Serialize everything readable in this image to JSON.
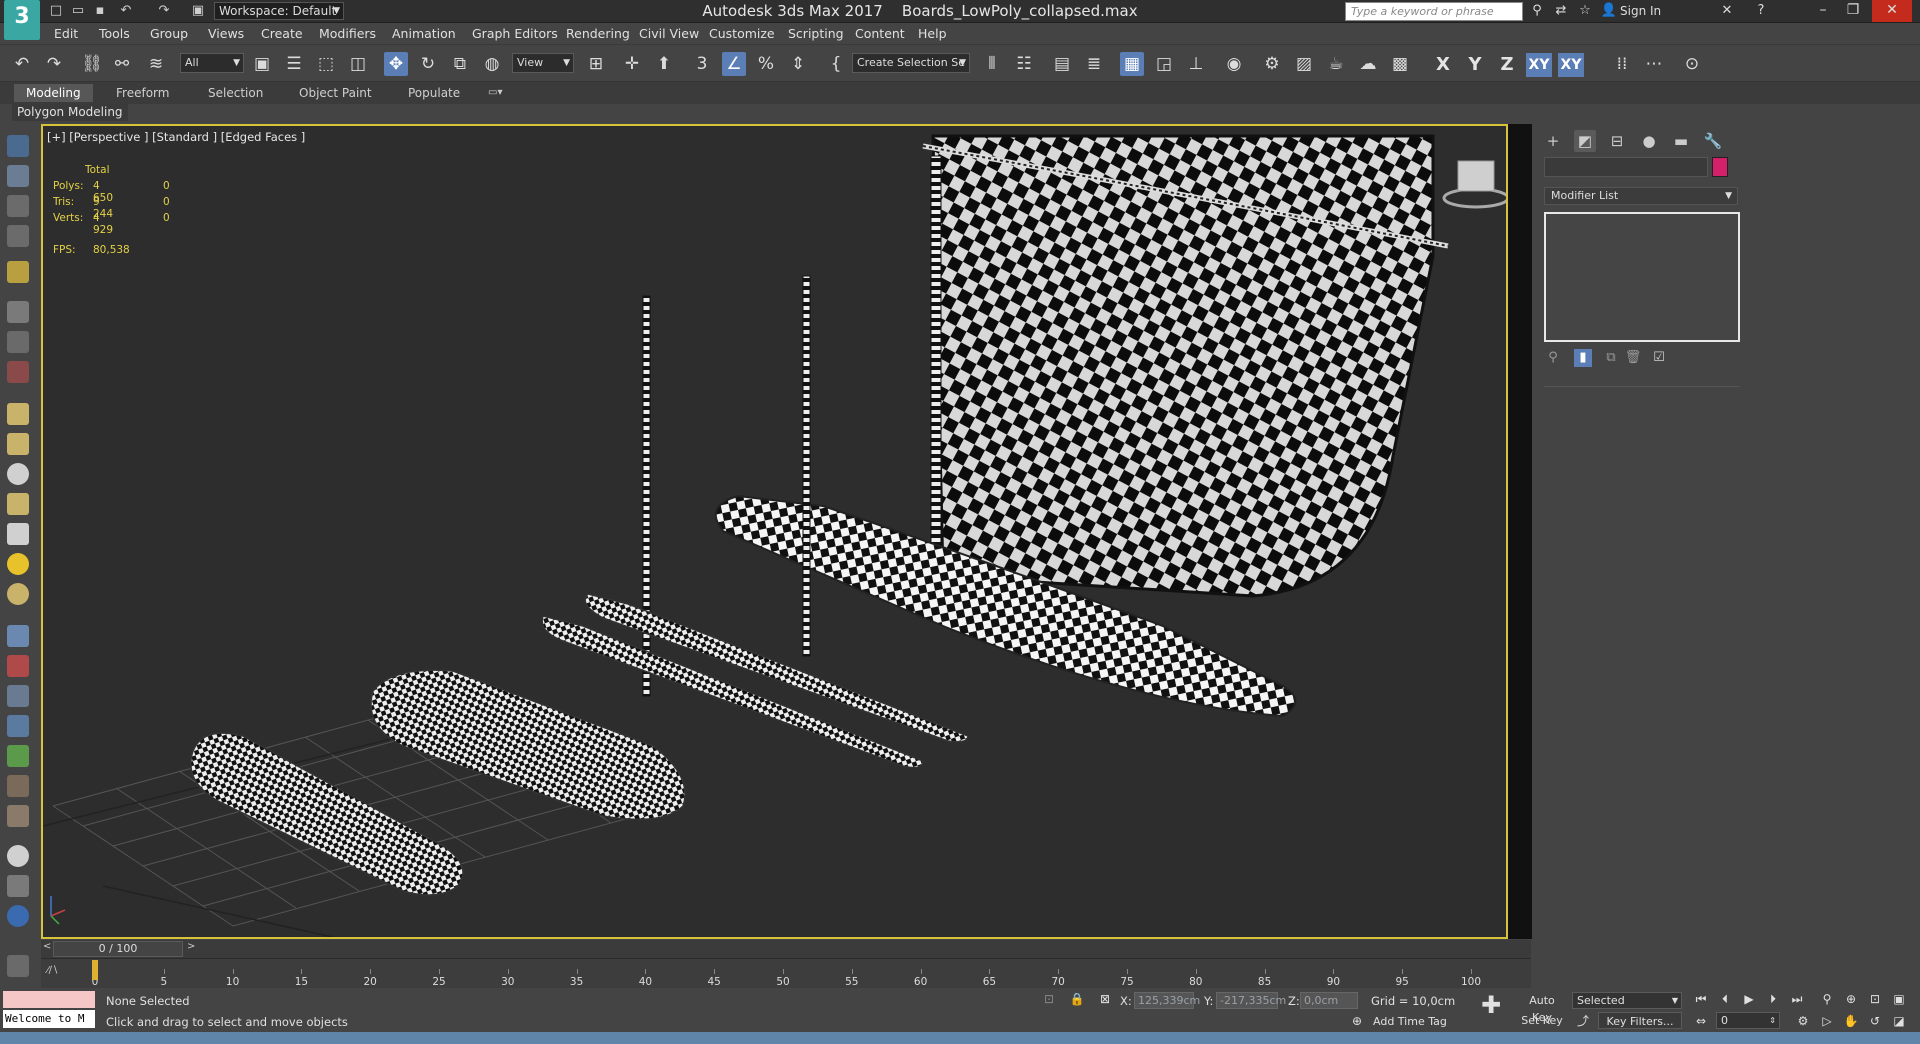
{
  "app": {
    "title": "Autodesk 3ds Max 2017    Boards_LowPoly_collapsed.max",
    "logo": "3",
    "workspace": "Workspace: Default",
    "search_placeholder": "Type a keyword or phrase",
    "signin": "Sign In"
  },
  "menu": [
    "Edit",
    "Tools",
    "Group",
    "Views",
    "Create",
    "Modifiers",
    "Animation",
    "Graph Editors",
    "Rendering",
    "Civil View",
    "Customize",
    "Scripting",
    "Content",
    "Help"
  ],
  "toolbar": {
    "filter": "All",
    "ref_coord": "View",
    "selection_set": "Create Selection Se",
    "axes": {
      "x": "X",
      "y": "Y",
      "z": "Z",
      "xy": "XY",
      "xy2": "XY"
    }
  },
  "ribbon": {
    "tabs": [
      "Modeling",
      "Freeform",
      "Selection",
      "Object Paint",
      "Populate"
    ],
    "active_tab": "Modeling",
    "panel": "Polygon Modeling"
  },
  "viewport": {
    "label": "[+] [Perspective ] [Standard ] [Edged Faces ]",
    "stats": {
      "header": "Total",
      "rows": [
        {
          "label": "Polys:",
          "total": "4 650",
          "sel": "0"
        },
        {
          "label": "Tris:",
          "total": "9 244",
          "sel": "0"
        },
        {
          "label": "Verts:",
          "total": "4 929",
          "sel": "0"
        }
      ],
      "fps_label": "FPS:",
      "fps": "80,538"
    }
  },
  "command_panel": {
    "modifier_list": "Modifier List",
    "object_color": "#d4206b"
  },
  "time": {
    "frame": "0 / 100",
    "ticks": [
      "0",
      "5",
      "10",
      "15",
      "20",
      "25",
      "30",
      "35",
      "40",
      "45",
      "50",
      "55",
      "60",
      "65",
      "70",
      "75",
      "80",
      "85",
      "90",
      "95",
      "100"
    ]
  },
  "status": {
    "selection": "None Selected",
    "prompt": "Click and drag to select and move objects",
    "welcome": "Welcome to M",
    "x_label": "X:",
    "x_value": "125,339cm",
    "y_label": "Y:",
    "y_value": "-217,335cm",
    "z_label": "Z:",
    "z_value": "0,0cm",
    "grid": "Grid = 10,0cm",
    "add_time_tag": "Add Time Tag",
    "auto_key": "Auto Key",
    "set_key": "Set Key",
    "key_mode": "Selected",
    "key_filters": "Key Filters...",
    "current_frame": "0"
  },
  "colors": {
    "viewport_border": "#d6c33b",
    "stats_text": "#e3d146",
    "accent_blue": "#5b7eb7"
  }
}
